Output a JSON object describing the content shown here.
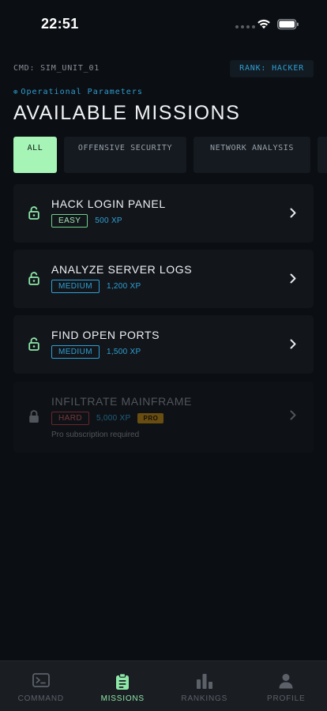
{
  "status_bar": {
    "time": "22:51",
    "wifi_icon": "wifi-icon",
    "battery_icon": "battery-icon"
  },
  "header": {
    "cmd_label": "CMD: SIM_UNIT_01",
    "rank_badge": "RANK: HACKER",
    "subtitle_icon": "⊕",
    "subtitle": "Operational Parameters",
    "title": "AVAILABLE MISSIONS"
  },
  "filters": [
    {
      "label": "ALL",
      "active": true
    },
    {
      "label": "OFFENSIVE SECURITY",
      "active": false
    },
    {
      "label": "NETWORK ANALYSIS",
      "active": false
    }
  ],
  "missions": [
    {
      "title": "HACK LOGIN PANEL",
      "difficulty": "EASY",
      "xp": "500 XP",
      "locked": false
    },
    {
      "title": "ANALYZE SERVER LOGS",
      "difficulty": "MEDIUM",
      "xp": "1,200 XP",
      "locked": false
    },
    {
      "title": "FIND OPEN PORTS",
      "difficulty": "MEDIUM",
      "xp": "1,500 XP",
      "locked": false
    },
    {
      "title": "INFILTRATE MAINFRAME",
      "difficulty": "HARD",
      "xp": "5,000 XP",
      "pro_badge": "PRO",
      "note": "Pro subscription required",
      "locked": true
    }
  ],
  "tab_bar": [
    {
      "label": "COMMAND",
      "icon": "terminal-icon",
      "active": false
    },
    {
      "label": "MISSIONS",
      "icon": "clipboard-icon",
      "active": true
    },
    {
      "label": "RANKINGS",
      "icon": "bar-chart-icon",
      "active": false
    },
    {
      "label": "PROFILE",
      "icon": "person-icon",
      "active": false
    }
  ],
  "colors": {
    "background": "#0b0e12",
    "accent_green": "#a6f5b7",
    "accent_blue": "#2f9fd3",
    "hard_red": "#b8393f",
    "pro_gold": "#b8820f"
  }
}
